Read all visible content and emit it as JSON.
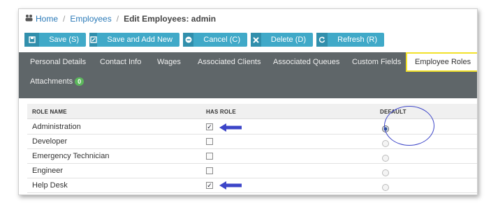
{
  "breadcrumb": {
    "home": "Home",
    "employees": "Employees",
    "current": "Edit Employees: admin",
    "separator": "/"
  },
  "toolbar": {
    "save": "Save (S)",
    "save_add": "Save and Add New",
    "cancel": "Cancel (C)",
    "delete": "Delete (D)",
    "refresh": "Refresh (R)"
  },
  "icons": {
    "home": "home-icon",
    "save": "save-icon",
    "save_add": "edit-icon",
    "cancel": "minus-circle-icon",
    "delete": "close-icon",
    "refresh": "refresh-icon"
  },
  "tabs": {
    "personal": "Personal Details",
    "contact": "Contact Info",
    "wages": "Wages",
    "clients": "Associated Clients",
    "queues": "Associated Queues",
    "custom": "Custom Fields",
    "roles": "Employee Roles",
    "attachments": "Attachments",
    "attachments_count": "0"
  },
  "table": {
    "headers": {
      "role": "ROLE NAME",
      "has_role": "HAS ROLE",
      "default": "DEFAULT"
    },
    "rows": [
      {
        "name": "Administration",
        "has_role": true,
        "default": true
      },
      {
        "name": "Developer",
        "has_role": false,
        "default": false
      },
      {
        "name": "Emergency Technician",
        "has_role": false,
        "default": false
      },
      {
        "name": "Engineer",
        "has_role": false,
        "default": false
      },
      {
        "name": "Help Desk",
        "has_role": true,
        "default": false
      }
    ]
  },
  "colors": {
    "accent": "#40a9c8",
    "tabbar": "#5f6669",
    "active_tab_outline": "#f2e12a",
    "annotation": "#3c45c8",
    "link": "#2b7ab8"
  }
}
